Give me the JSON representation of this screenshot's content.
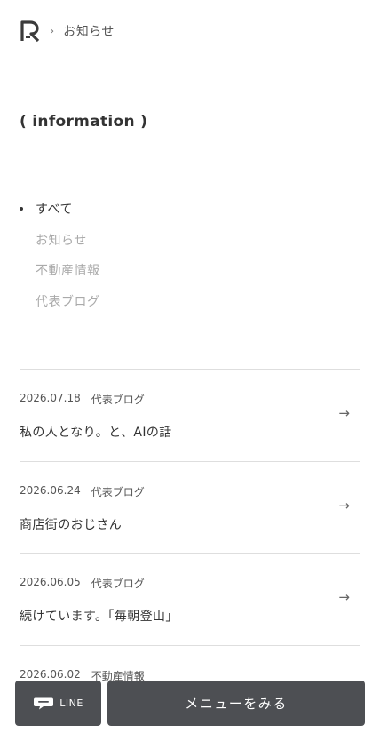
{
  "breadcrumb": {
    "separator": "›",
    "current": "お知らせ"
  },
  "page_title": "( information )",
  "categories": [
    {
      "label": "すべて",
      "active": true
    },
    {
      "label": "お知らせ",
      "active": false
    },
    {
      "label": "不動産情報",
      "active": false
    },
    {
      "label": "代表ブログ",
      "active": false
    }
  ],
  "news": [
    {
      "date": "2026.07.18",
      "category": "代表ブログ",
      "title": "私の人となり。と、AIの話",
      "arrow": "→"
    },
    {
      "date": "2026.06.24",
      "category": "代表ブログ",
      "title": "商店街のおじさん",
      "arrow": "→"
    },
    {
      "date": "2026.06.05",
      "category": "代表ブログ",
      "title": "続けています。「毎朝登山」",
      "arrow": "→"
    },
    {
      "date": "2026.06.02",
      "category": "不動産情報",
      "title": "",
      "arrow": "→"
    }
  ],
  "bottom_bar": {
    "line_label": "LINE",
    "line_icon": "chat-bubble-icon",
    "menu_label": "メニューをみる"
  }
}
